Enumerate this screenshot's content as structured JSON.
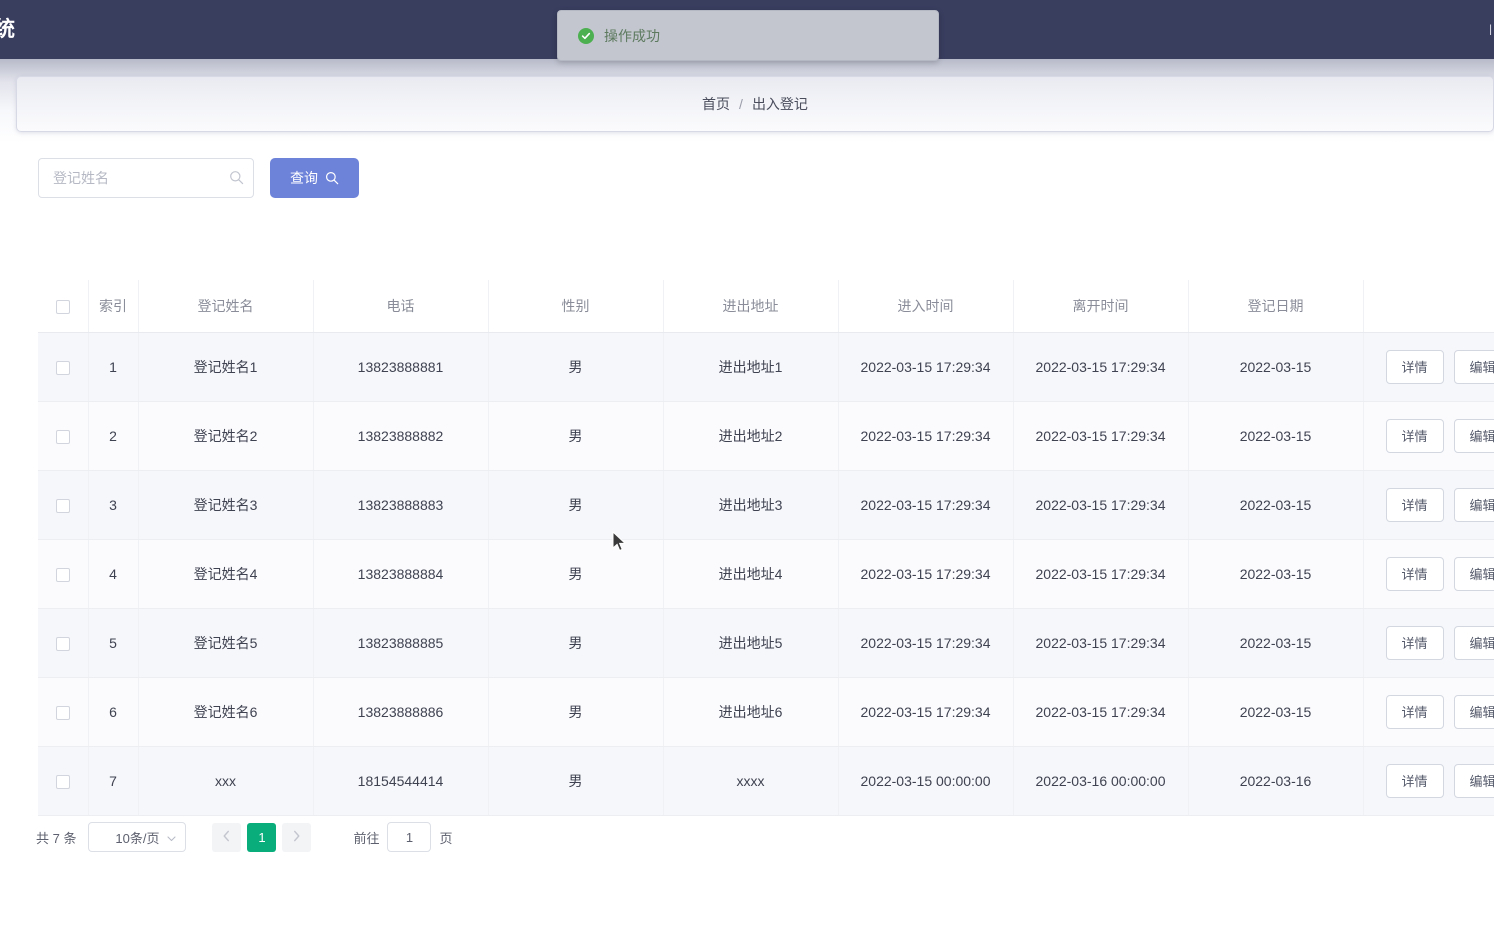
{
  "header": {
    "brand_tail": "统",
    "right_stub": "|"
  },
  "toast": {
    "message": "操作成功",
    "icon": "check-circle-icon",
    "color": "#4caf50"
  },
  "breadcrumb": {
    "home": "首页",
    "separator": "/",
    "current": "出入登记"
  },
  "search": {
    "placeholder": "登记姓名",
    "value": "",
    "input_icon": "search-icon",
    "button_label": "查询",
    "button_icon": "search-icon",
    "button_color": "#6d82d9"
  },
  "table": {
    "columns": [
      "索引",
      "登记姓名",
      "电话",
      "性别",
      "进出地址",
      "进入时间",
      "离开时间",
      "登记日期"
    ],
    "actions": {
      "detail": "详情",
      "edit": "编辑"
    },
    "rows": [
      {
        "index": "1",
        "name": "登记姓名1",
        "phone": "13823888881",
        "gender": "男",
        "address": "进出地址1",
        "enter_time": "2022-03-15 17:29:34",
        "leave_time": "2022-03-15 17:29:34",
        "reg_date": "2022-03-15"
      },
      {
        "index": "2",
        "name": "登记姓名2",
        "phone": "13823888882",
        "gender": "男",
        "address": "进出地址2",
        "enter_time": "2022-03-15 17:29:34",
        "leave_time": "2022-03-15 17:29:34",
        "reg_date": "2022-03-15"
      },
      {
        "index": "3",
        "name": "登记姓名3",
        "phone": "13823888883",
        "gender": "男",
        "address": "进出地址3",
        "enter_time": "2022-03-15 17:29:34",
        "leave_time": "2022-03-15 17:29:34",
        "reg_date": "2022-03-15"
      },
      {
        "index": "4",
        "name": "登记姓名4",
        "phone": "13823888884",
        "gender": "男",
        "address": "进出地址4",
        "enter_time": "2022-03-15 17:29:34",
        "leave_time": "2022-03-15 17:29:34",
        "reg_date": "2022-03-15"
      },
      {
        "index": "5",
        "name": "登记姓名5",
        "phone": "13823888885",
        "gender": "男",
        "address": "进出地址5",
        "enter_time": "2022-03-15 17:29:34",
        "leave_time": "2022-03-15 17:29:34",
        "reg_date": "2022-03-15"
      },
      {
        "index": "6",
        "name": "登记姓名6",
        "phone": "13823888886",
        "gender": "男",
        "address": "进出地址6",
        "enter_time": "2022-03-15 17:29:34",
        "leave_time": "2022-03-15 17:29:34",
        "reg_date": "2022-03-15"
      },
      {
        "index": "7",
        "name": "xxx",
        "phone": "18154544414",
        "gender": "男",
        "address": "xxxx",
        "enter_time": "2022-03-15 00:00:00",
        "leave_time": "2022-03-16 00:00:00",
        "reg_date": "2022-03-16"
      }
    ]
  },
  "pagination": {
    "total_text": "共 7 条",
    "page_size": "10条/页",
    "prev_icon": "chevron-left-icon",
    "next_icon": "chevron-right-icon",
    "current_page": "1",
    "jump_prefix": "前往",
    "jump_value": "1",
    "jump_suffix": "页",
    "active_color": "#09ad7b"
  }
}
